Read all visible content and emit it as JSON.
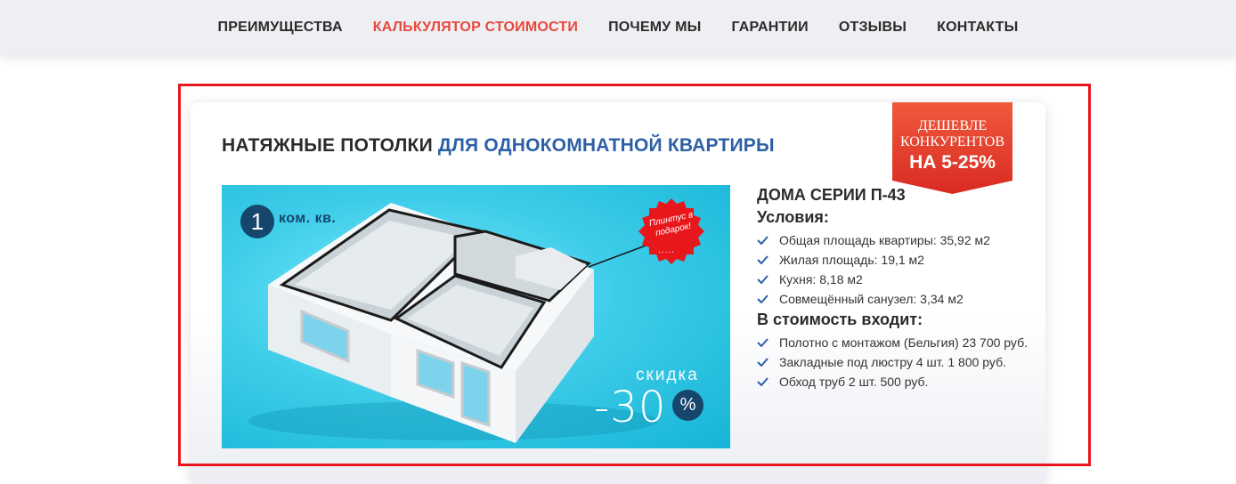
{
  "nav": {
    "items": [
      {
        "label": "ПРЕИМУЩЕСТВА",
        "active": false
      },
      {
        "label": "КАЛЬКУЛЯТОР СТОИМОСТИ",
        "active": true
      },
      {
        "label": "ПОЧЕМУ МЫ",
        "active": false
      },
      {
        "label": "ГАРАНТИИ",
        "active": false
      },
      {
        "label": "ОТЗЫВЫ",
        "active": false
      },
      {
        "label": "КОНТАКТЫ",
        "active": false
      }
    ]
  },
  "card": {
    "title_main": "НАТЯЖНЫЕ ПОТОЛКИ ",
    "title_accent": "ДЛЯ ОДНОКОМНАТНОЙ КВАРТИРЫ",
    "ribbon": {
      "line1": "ДЕШЕВЛЕ",
      "line2": "КОНКУРЕНТОВ",
      "line3": "НА 5-25%"
    },
    "hero": {
      "rooms_number": "1",
      "rooms_label": "ком. кв.",
      "gift_text": "Плинтус в подарок!",
      "gift_dots": ".....",
      "discount_label": "скидка",
      "discount_value": "-30",
      "discount_percent": "%"
    },
    "info": {
      "series": "ДОМА СЕРИИ П-43",
      "conditions_heading": "Условия:",
      "conditions": [
        "Общая площадь квартиры: 35,92 м2",
        "Жилая площадь: 19,1 м2",
        "Кухня: 8,18 м2",
        "Совмещённый санузел: 3,34 м2"
      ],
      "includes_heading": "В стоимость входит:",
      "includes": [
        "Полотно с монтажом (Бельгия) 23 700 руб.",
        "Закладные под люстру 4 шт. 1 800 руб.",
        "Обход труб 2 шт. 500 руб."
      ]
    }
  },
  "colors": {
    "accent_red": "#e8483c",
    "title_blue": "#2d5fa6",
    "navy": "#17466c",
    "check_blue": "#2d5fa6",
    "frame_red": "#e8171c"
  }
}
